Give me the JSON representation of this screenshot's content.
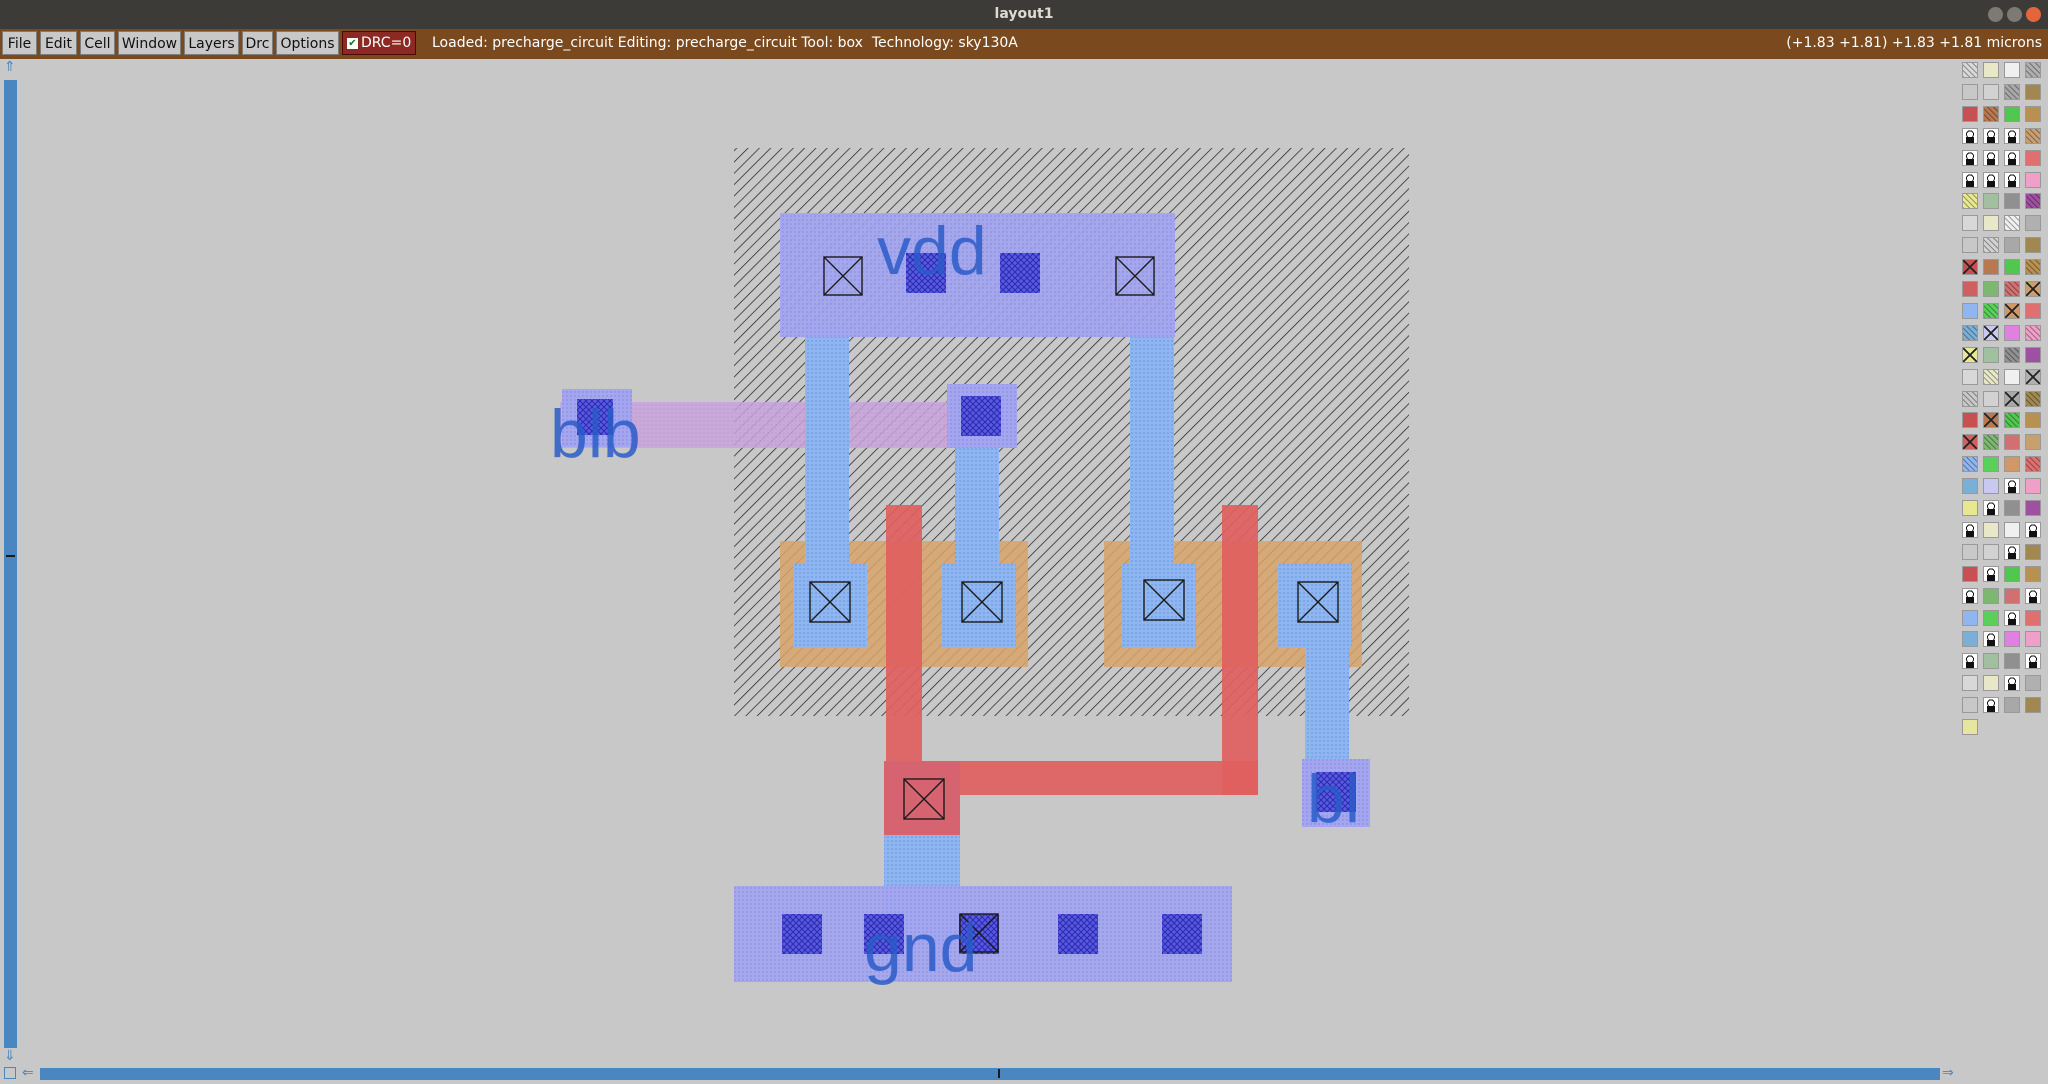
{
  "window": {
    "title": "layout1"
  },
  "menu": {
    "items": [
      "File",
      "Edit",
      "Cell",
      "Window",
      "Layers",
      "Drc",
      "Options"
    ],
    "drc_label": "DRC=0"
  },
  "status": {
    "text": "Loaded: precharge_circuit Editing: precharge_circuit Tool: box  Technology: sky130A",
    "coords": "(+1.83 +1.81) +1.83 +1.81 microns"
  },
  "layout": {
    "labels": {
      "vdd": "vdd",
      "blb": "blb",
      "bl": "bl",
      "gnd": "gnd"
    }
  },
  "colors": {
    "menubar": "#7a4a1e",
    "nwell_hatch": "#1a1a1a",
    "metal1": "#a4a6f0",
    "poly": "#e06060",
    "diffusion": "#d7a36a",
    "local_interconnect": "#8fb6f0",
    "metal2": "#c9a3dc",
    "scrollbar": "#4a86c0"
  },
  "palette": {
    "icons": [
      "layer-swatch",
      "lock-icon",
      "contact-cross-icon"
    ]
  }
}
